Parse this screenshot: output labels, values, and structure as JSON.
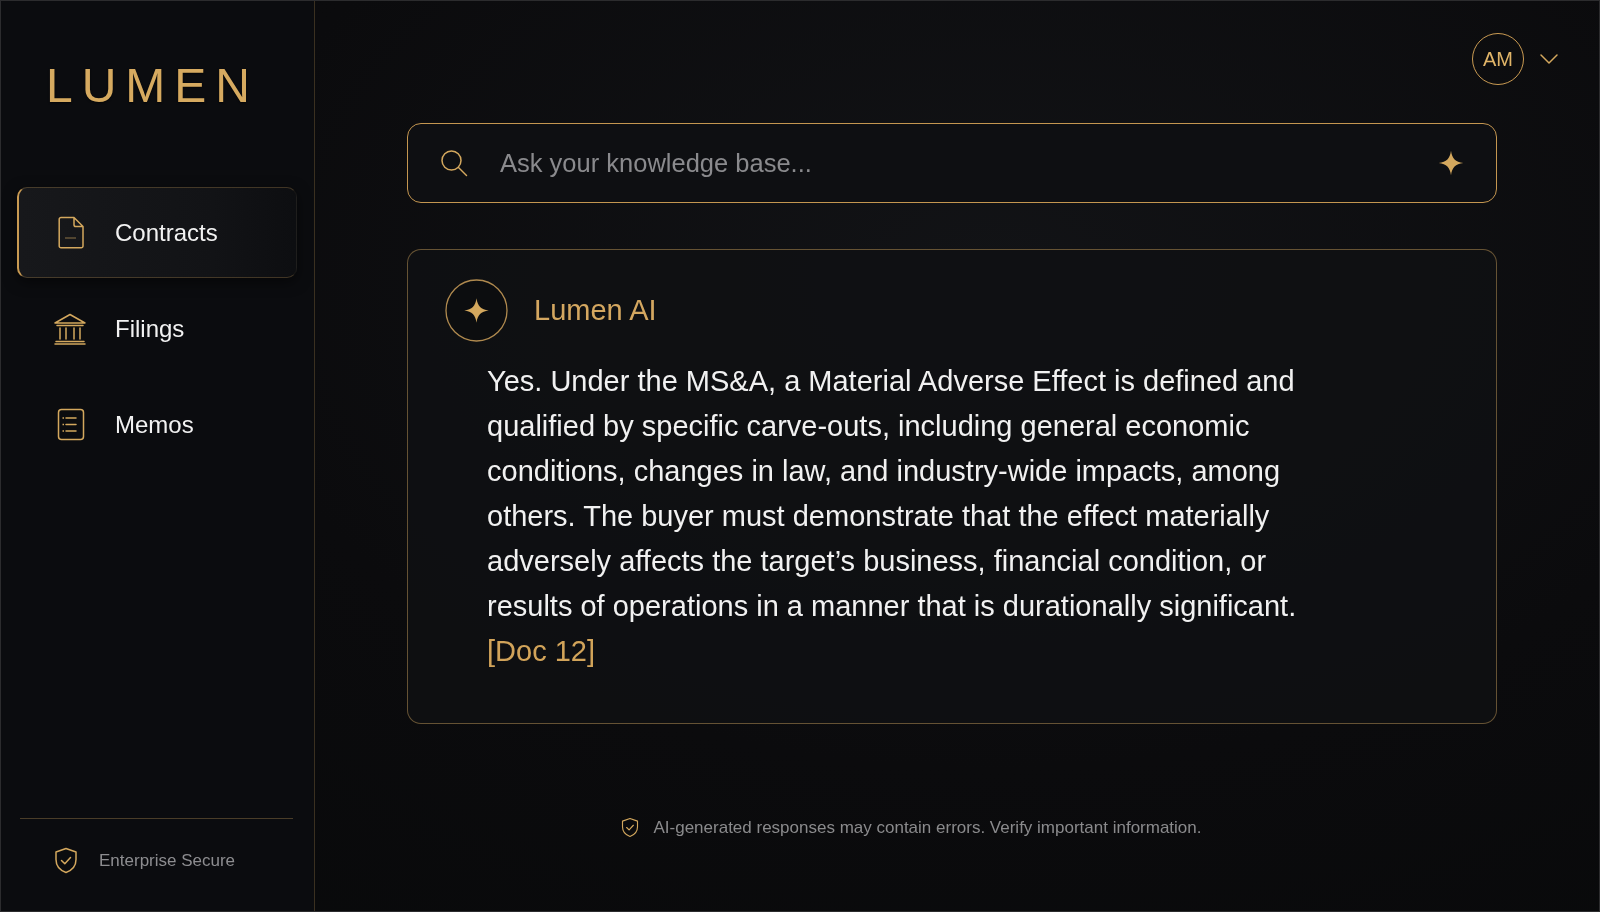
{
  "sidebar": {
    "logo": "LUMEN",
    "nav_items": [
      {
        "label": "Contracts",
        "selected": true
      },
      {
        "label": "Filings",
        "selected": false
      },
      {
        "label": "Memos",
        "selected": false
      }
    ],
    "footer": {
      "label": "Enterprise Secure"
    }
  },
  "header": {
    "user": {
      "initials": "AM"
    }
  },
  "search": {
    "placeholder": "Ask your knowledge base..."
  },
  "answer": {
    "author": "Lumen AI",
    "text": "Yes. Under the MS&A, a Material Adverse Effect is defined and qualified by specific carve-outs, including general economic conditions, changes in law, and industry-wide impacts, among others. The buyer must demonstrate that the effect materially adversely affects the target’s business, financial condition, or results of operations in a manner that is durationally significant.",
    "citation": "[Doc 12]"
  },
  "disclaimer": "AI-generated responses may contain errors. Verify important information."
}
